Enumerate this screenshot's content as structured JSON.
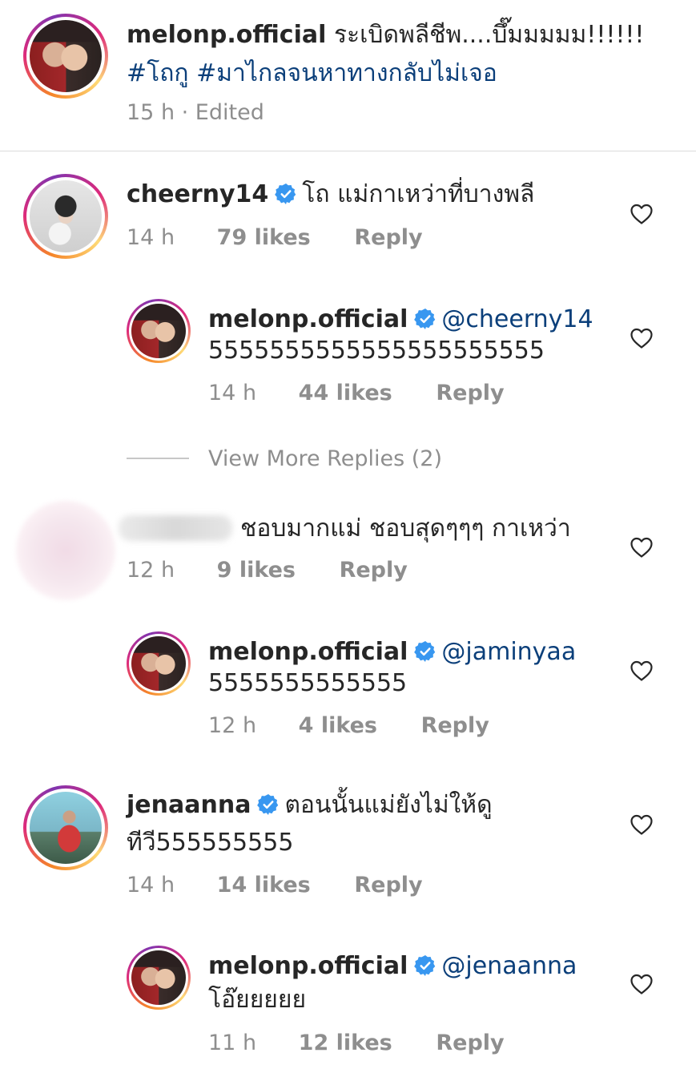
{
  "caption": {
    "username": "melonp.official",
    "text": "ระเบิดพลีชีพ....บึ๊มมมมม!!!!!!",
    "hashtags": "#โถกู #มาไกลจนหาทางกลับไม่เจอ",
    "meta": "15 h · Edited"
  },
  "comments": [
    {
      "username": "cheerny14",
      "verified": true,
      "text": "โถ แม่กาเหว่าที่บางพลี",
      "time": "14 h",
      "likes": "79 likes",
      "reply": "Reply"
    },
    {
      "username": "melonp.official",
      "verified": true,
      "mention": "@cheerny14",
      "text": "5555555555555555555555",
      "time": "14 h",
      "likes": "44 likes",
      "reply": "Reply"
    },
    {
      "username": "",
      "verified": false,
      "text": "ชอบมากแม่ ชอบสุดๆๆๆ กาเหว่า",
      "time": "12 h",
      "likes": "9 likes",
      "reply": "Reply"
    },
    {
      "username": "melonp.official",
      "verified": true,
      "mention": "@jaminyaa",
      "text": "5555555555555",
      "time": "12 h",
      "likes": "4 likes",
      "reply": "Reply"
    },
    {
      "username": "jenaanna",
      "verified": true,
      "text": "ตอนนั้นแม่ยังไม่ให้ดู",
      "text2": "ทีวี555555555",
      "time": "14 h",
      "likes": "14 likes",
      "reply": "Reply"
    },
    {
      "username": "melonp.official",
      "verified": true,
      "mention": "@jenaanna",
      "text": "โอ๊ยยยยย",
      "time": "11 h",
      "likes": "12 likes",
      "reply": "Reply"
    }
  ],
  "view_more_replies": "View More Replies (2)",
  "icons": {
    "verified": "verified-badge-icon",
    "like": "heart-outline-icon"
  },
  "colors": {
    "text": "#262626",
    "secondary": "#8e8e8e",
    "hashtag": "#0b3f7a",
    "verified": "#3897f0"
  }
}
